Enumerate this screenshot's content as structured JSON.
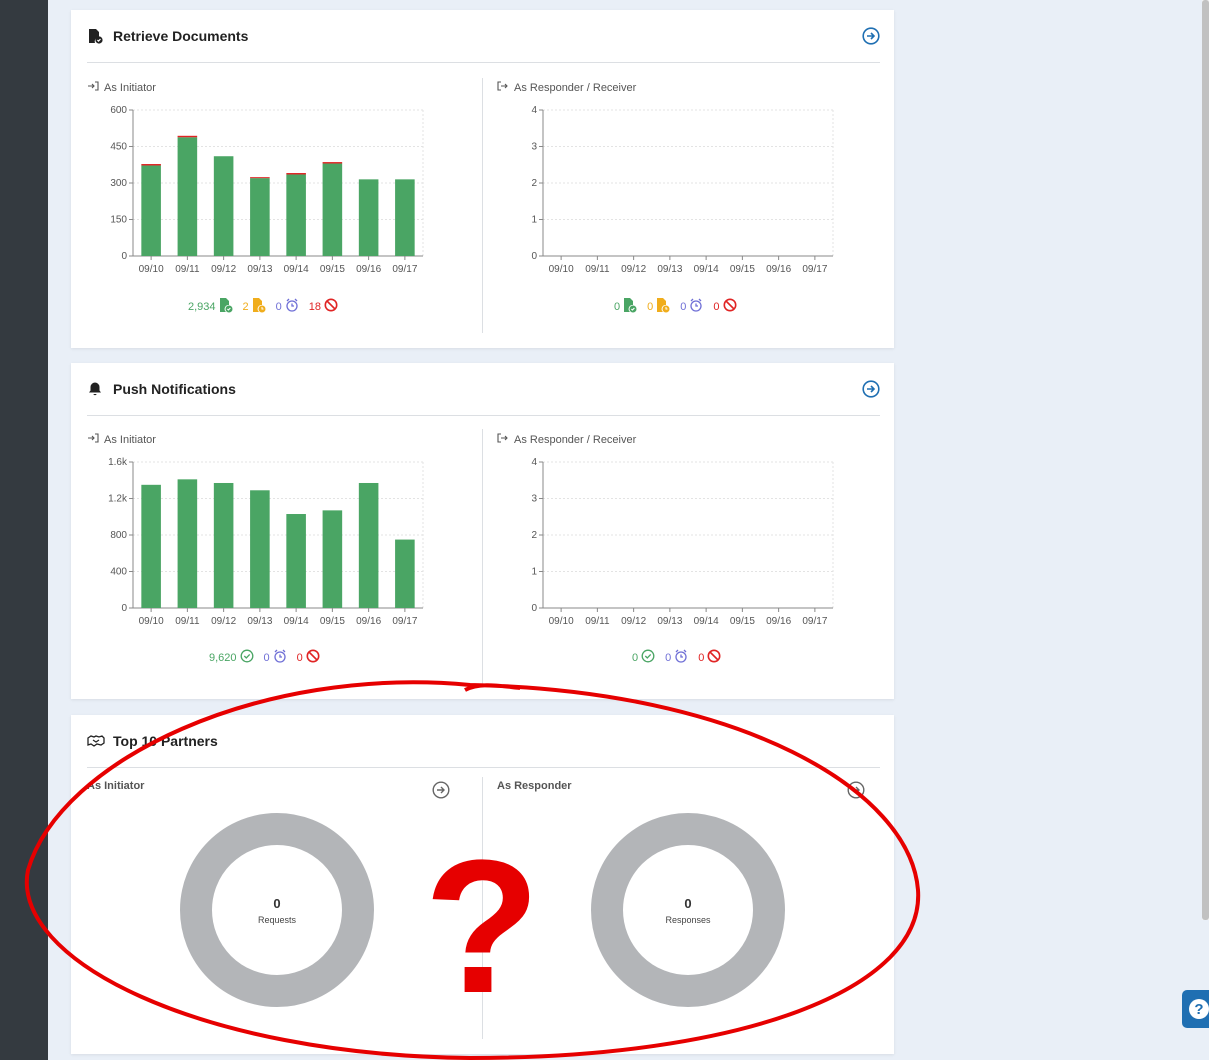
{
  "cards": {
    "retrieve": {
      "title": "Retrieve Documents",
      "initiator_label": "As Initiator",
      "responder_label": "As Responder / Receiver",
      "initiator_stats": {
        "success": "2,934",
        "partial": "2",
        "timeout": "0",
        "error": "18"
      },
      "responder_stats": {
        "success": "0",
        "partial": "0",
        "timeout": "0",
        "error": "0"
      }
    },
    "push": {
      "title": "Push Notifications",
      "initiator_label": "As Initiator",
      "responder_label": "As Responder / Receiver",
      "initiator_stats": {
        "success": "9,620",
        "timeout": "0",
        "error": "0"
      },
      "responder_stats": {
        "success": "0",
        "timeout": "0",
        "error": "0"
      }
    },
    "partners": {
      "title": "Top 10 Partners",
      "initiator_label": "As Initiator",
      "responder_label": "As Responder",
      "initiator_donut": {
        "value": "0",
        "label": "Requests"
      },
      "responder_donut": {
        "value": "0",
        "label": "Responses"
      }
    }
  },
  "colors": {
    "success": "#4aa564",
    "partial": "#f0ad1c",
    "timeout": "#6f6fd6",
    "error": "#e02424",
    "link": "#1f6fb2",
    "donut": "#b3b5b8",
    "annotation": "#e60000"
  },
  "icons": {
    "retrieve": "document-check-icon",
    "push": "bell-icon",
    "partners": "handshake-icon",
    "go": "arrow-circle-right-icon",
    "initiator": "sign-in-icon",
    "responder": "sign-out-icon",
    "help": "question-icon"
  },
  "annotation": {
    "symbol": "?"
  },
  "chart_data": [
    {
      "id": "retrieve-initiator",
      "type": "bar",
      "categories": [
        "09/10",
        "09/11",
        "09/12",
        "09/13",
        "09/14",
        "09/15",
        "09/16",
        "09/17"
      ],
      "series": [
        {
          "values": [
            372,
            488,
            410,
            320,
            335,
            380,
            315,
            315
          ]
        },
        {
          "values": [
            6,
            6,
            0,
            4,
            6,
            6,
            0,
            0
          ]
        }
      ],
      "yticks": [
        "0",
        "150",
        "300",
        "450",
        "600"
      ],
      "ylim": [
        0,
        600
      ],
      "grid": true
    },
    {
      "id": "retrieve-responder",
      "type": "bar",
      "categories": [
        "09/10",
        "09/11",
        "09/12",
        "09/13",
        "09/14",
        "09/15",
        "09/16",
        "09/17"
      ],
      "series": [
        {
          "values": [
            0,
            0,
            0,
            0,
            0,
            0,
            0,
            0
          ]
        }
      ],
      "yticks": [
        "0",
        "1",
        "2",
        "3",
        "4"
      ],
      "ylim": [
        0,
        4
      ],
      "grid": true
    },
    {
      "id": "push-initiator",
      "type": "bar",
      "categories": [
        "09/10",
        "09/11",
        "09/12",
        "09/13",
        "09/14",
        "09/15",
        "09/16",
        "09/17"
      ],
      "series": [
        {
          "values": [
            1350,
            1410,
            1370,
            1290,
            1030,
            1070,
            1370,
            750
          ]
        }
      ],
      "yticks": [
        "0",
        "400",
        "800",
        "1.2k",
        "1.6k"
      ],
      "ylim": [
        0,
        1600
      ],
      "grid": true
    },
    {
      "id": "push-responder",
      "type": "bar",
      "categories": [
        "09/10",
        "09/11",
        "09/12",
        "09/13",
        "09/14",
        "09/15",
        "09/16",
        "09/17"
      ],
      "series": [
        {
          "values": [
            0,
            0,
            0,
            0,
            0,
            0,
            0,
            0
          ]
        }
      ],
      "yticks": [
        "0",
        "1",
        "2",
        "3",
        "4"
      ],
      "ylim": [
        0,
        4
      ],
      "grid": true
    }
  ]
}
